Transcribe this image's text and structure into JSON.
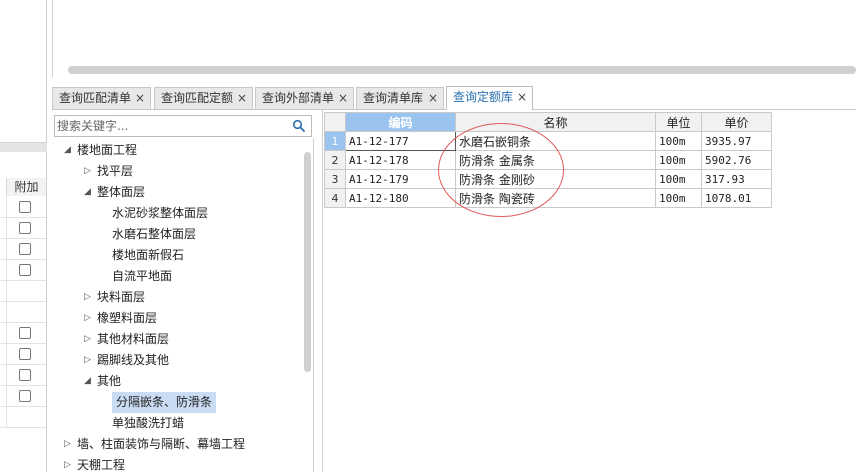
{
  "left_panel": {
    "column_header": "附加",
    "checkbox_rows": [
      true,
      true,
      true,
      true,
      false,
      false,
      true,
      true,
      true,
      true,
      false
    ]
  },
  "tabs": [
    {
      "label": "查询匹配清单",
      "close": "×"
    },
    {
      "label": "查询匹配定额",
      "close": "×"
    },
    {
      "label": "查询外部清单",
      "close": "×"
    },
    {
      "label": "查询清单库",
      "close": "×"
    },
    {
      "label": "查询定额库",
      "close": "×",
      "active": true
    }
  ],
  "search": {
    "placeholder": "搜索关键字..."
  },
  "tree": [
    {
      "label": "楼地面工程",
      "arrow": "◢",
      "level": 0
    },
    {
      "label": "找平层",
      "arrow": "▷",
      "level": 1
    },
    {
      "label": "整体面层",
      "arrow": "◢",
      "level": 1
    },
    {
      "label": "水泥砂浆整体面层",
      "arrow": "",
      "level": 2
    },
    {
      "label": "水磨石整体面层",
      "arrow": "",
      "level": 2
    },
    {
      "label": "楼地面新假石",
      "arrow": "",
      "level": 2
    },
    {
      "label": "自流平地面",
      "arrow": "",
      "level": 2
    },
    {
      "label": "块料面层",
      "arrow": "▷",
      "level": 1
    },
    {
      "label": "橡塑料面层",
      "arrow": "▷",
      "level": 1
    },
    {
      "label": "其他材料面层",
      "arrow": "▷",
      "level": 1
    },
    {
      "label": "踢脚线及其他",
      "arrow": "▷",
      "level": 1
    },
    {
      "label": "其他",
      "arrow": "◢",
      "level": 1
    },
    {
      "label": "分隔嵌条、防滑条",
      "arrow": "",
      "level": 2,
      "selected": true
    },
    {
      "label": "单独酸洗打蜡",
      "arrow": "",
      "level": 2
    },
    {
      "label": "墙、柱面装饰与隔断、幕墙工程",
      "arrow": "▷",
      "level": 0
    },
    {
      "label": "天棚工程",
      "arrow": "▷",
      "level": 0
    }
  ],
  "grid": {
    "headers": {
      "code": "编码",
      "name": "名称",
      "unit": "单位",
      "price": "单价"
    },
    "rows": [
      {
        "num": "1",
        "code": "A1-12-177",
        "name": "水磨石嵌铜条",
        "unit": "100m",
        "price": "3935.97"
      },
      {
        "num": "2",
        "code": "A1-12-178",
        "name": "防滑条 金属条",
        "unit": "100m",
        "price": "5902.76"
      },
      {
        "num": "3",
        "code": "A1-12-179",
        "name": "防滑条 金刚砂",
        "unit": "100m",
        "price": "317.93"
      },
      {
        "num": "4",
        "code": "A1-12-180",
        "name": "防滑条 陶瓷砖",
        "unit": "100m",
        "price": "1078.01"
      }
    ]
  },
  "colors": {
    "accent": "#2a6fb0",
    "selection": "#c9dcf3",
    "header_selected": "#9ac4ee",
    "annotation": "#e05a5a"
  }
}
